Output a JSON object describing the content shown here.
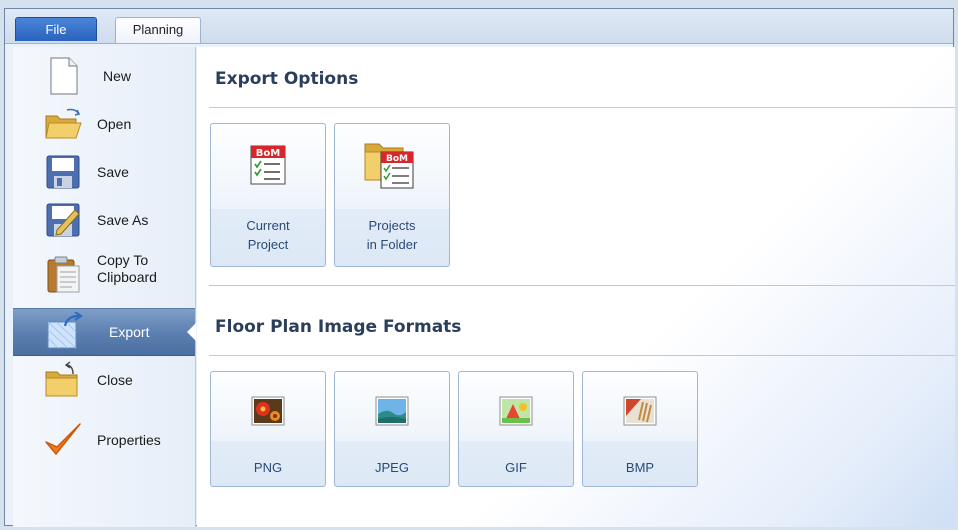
{
  "tabs": {
    "file": "File",
    "planning": "Planning"
  },
  "sidebar": {
    "items": [
      {
        "label": "New",
        "icon": "new-document-icon"
      },
      {
        "label": "Open",
        "icon": "open-folder-icon"
      },
      {
        "label": "Save",
        "icon": "save-disk-icon"
      },
      {
        "label": "Save As",
        "icon": "save-as-icon"
      },
      {
        "label_line1": "Copy To",
        "label_line2": "Clipboard",
        "icon": "clipboard-icon"
      },
      {
        "label": "Export",
        "icon": "export-icon",
        "active": true
      },
      {
        "label": "Close",
        "icon": "close-folder-icon"
      },
      {
        "label": "Properties",
        "icon": "checkmark-icon"
      }
    ]
  },
  "export_options": {
    "title": "Export Options",
    "tiles": [
      {
        "line1": "Current",
        "line2": "Project",
        "icon": "bom-icon"
      },
      {
        "line1": "Projects",
        "line2": "in Folder",
        "icon": "bom-folder-icon"
      }
    ]
  },
  "image_formats": {
    "title": "Floor Plan Image Formats",
    "tiles": [
      {
        "label": "PNG",
        "icon": "png-image-icon"
      },
      {
        "label": "JPEG",
        "icon": "jpeg-image-icon"
      },
      {
        "label": "GIF",
        "icon": "gif-image-icon"
      },
      {
        "label": "BMP",
        "icon": "bmp-image-icon"
      }
    ]
  },
  "colors": {
    "accent": "#2a62bd",
    "active_item": "#5a7eaf",
    "tile_text": "#2b4a78"
  }
}
